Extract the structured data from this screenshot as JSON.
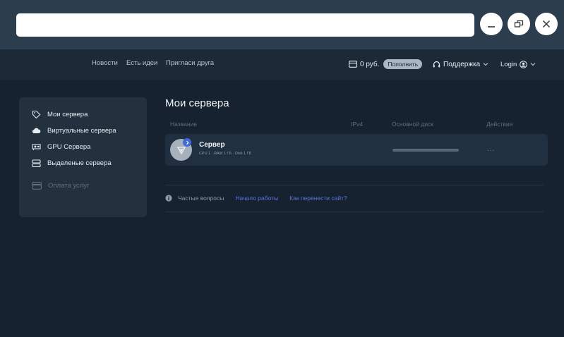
{
  "nav": {
    "links": [
      "Новости",
      "Есть идеи",
      "Пригласи друга"
    ],
    "balance": "0 руб.",
    "topup_label": "Пополнить",
    "support_label": "Поддержка",
    "login_label": "Login"
  },
  "sidebar": {
    "items": [
      {
        "label": "Мои сервера",
        "icon": "tag-icon"
      },
      {
        "label": "Виртуальные сервера",
        "icon": "cloud-icon"
      },
      {
        "label": "GPU Сервера",
        "icon": "gpu-icon"
      },
      {
        "label": "Выделеные сервера",
        "icon": "server-rack-icon"
      }
    ],
    "payment_label": "Оплата услуг"
  },
  "main": {
    "title": "Мои сервера",
    "columns": [
      "Название",
      "IPv4",
      "Основной диск",
      "Действия"
    ],
    "servers": [
      {
        "name": "Сервер",
        "spec": "CPU 1 · RAM 1 ГБ · Disk 1 ГБ",
        "actions": "..."
      }
    ],
    "faq": {
      "label": "Частые вопросы",
      "links": [
        "Начало работы",
        "Как перенести сайт?"
      ]
    }
  },
  "colors": {
    "background": "#16222f",
    "panel": "#23303d",
    "accent": "#5b74e0",
    "badge": "#3e6ad8"
  }
}
